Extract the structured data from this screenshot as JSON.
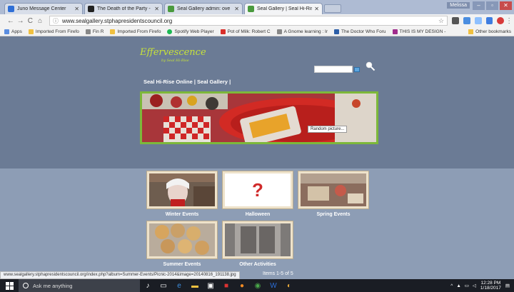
{
  "browser": {
    "tabs": [
      {
        "label": "Juno Message Center",
        "favicon_color": "#2f6fd6",
        "active": false
      },
      {
        "label": "The Death of the Party -",
        "favicon_color": "#222222",
        "active": false
      },
      {
        "label": "Seal Gallery admin: ove",
        "favicon_color": "#4a9a3e",
        "active": false
      },
      {
        "label": "Seal Gallery | Seal Hi-Ris",
        "favicon_color": "#4a9a3e",
        "active": true
      }
    ],
    "user_name": "Melissa",
    "url": "www.sealgallery.stphapresidentscouncil.org",
    "bookmarks": [
      {
        "label": "Apps",
        "color": "#5a8de0"
      },
      {
        "label": "Imported From Firefo",
        "color": "#f0c040"
      },
      {
        "label": "Fin R",
        "color": "#888888"
      },
      {
        "label": "Imported From Firefo",
        "color": "#f0c040"
      },
      {
        "label": "Spotify Web Player",
        "color": "#1db954"
      },
      {
        "label": "Pot of Milk: Robert C",
        "color": "#d9302a"
      },
      {
        "label": "A Gnome learning : Ir",
        "color": "#888888"
      },
      {
        "label": "The Doctor Who Foru",
        "color": "#2c5ea8"
      },
      {
        "label": "THIS IS MY DESIGN -",
        "color": "#a02c8c"
      }
    ],
    "other_bookmarks": "Other bookmarks"
  },
  "site": {
    "logo_text": "Effervescence",
    "logo_subtitle": "by Seal Hi-Rise",
    "nav_text": "Seal Hi-Rise Online | Seal Gallery |",
    "hero_tooltip": "Random picture...",
    "galleries": [
      {
        "label": "Winter Events"
      },
      {
        "label": "Halloween",
        "symbol": "?"
      },
      {
        "label": "Spring Events"
      },
      {
        "label": "Summer Events"
      },
      {
        "label": "Other Activities"
      }
    ],
    "pager_text": "Items 1-5 of 5",
    "status_url": "www.sealgallery.stphapresidentscouncil.org/index.php?album=Summer-Events/Picnic-2014&image=20140816_191138.jpg"
  },
  "taskbar": {
    "search_placeholder": "Ask me anything",
    "time": "12:28 PM",
    "date": "1/18/2017"
  }
}
